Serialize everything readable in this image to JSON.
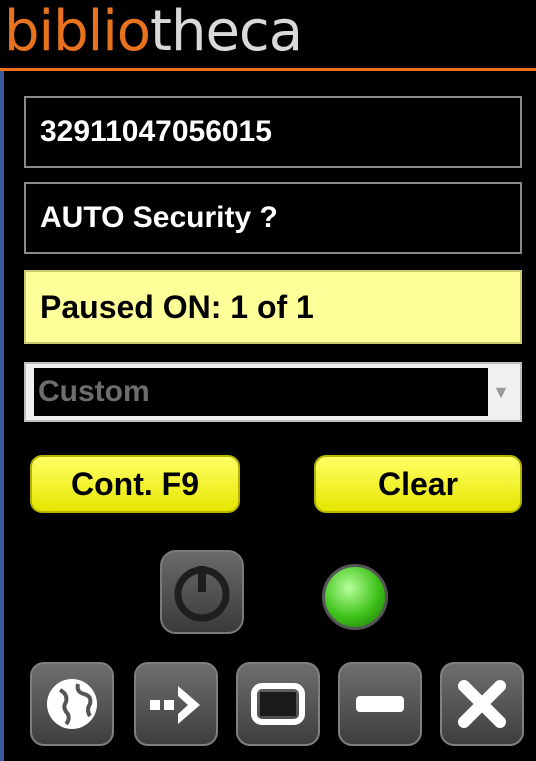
{
  "app": {
    "logo_part1": "biblio",
    "logo_part2": "theca",
    "brand_color": "#e8731e"
  },
  "fields": {
    "barcode": "32911047056015",
    "security": "AUTO Security ?"
  },
  "status": {
    "text": "Paused ON: 1 of 1",
    "color": "#ffff99"
  },
  "dropdown": {
    "selected": "Custom"
  },
  "buttons": {
    "continue_label": "Cont. F9",
    "clear_label": "Clear"
  },
  "indicators": {
    "power_icon": "power-icon",
    "led_color": "#3fc21a"
  },
  "toolbar": [
    {
      "icon": "globe-icon"
    },
    {
      "icon": "arrow-right-icon"
    },
    {
      "icon": "window-icon"
    },
    {
      "icon": "minimize-icon"
    },
    {
      "icon": "close-icon"
    }
  ]
}
